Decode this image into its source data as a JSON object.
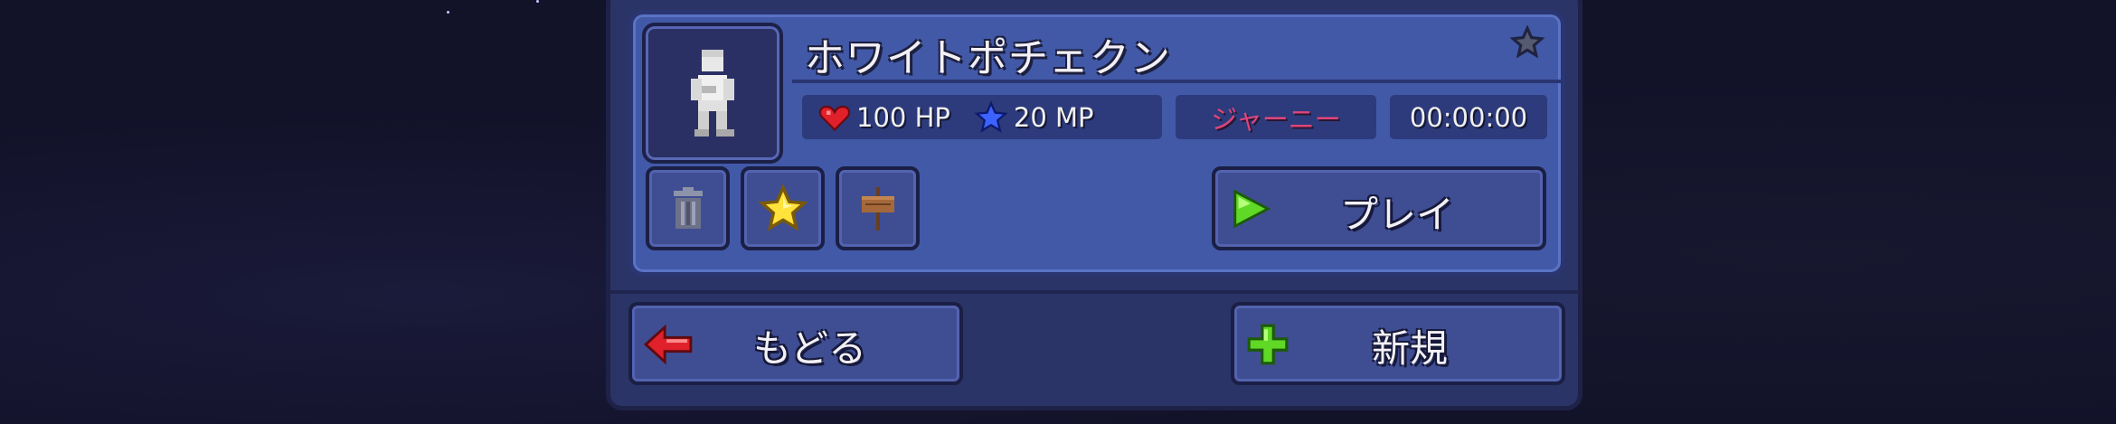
{
  "character": {
    "name": "ホワイトポチェクン",
    "hp": "100 HP",
    "mp": "20 MP",
    "mode": "ジャーニー",
    "playtime": "00:00:00"
  },
  "actions": {
    "play_label": "プレイ",
    "back_label": "もどる",
    "new_label": "新規"
  },
  "icons": {
    "delete": "trash-icon",
    "favorite": "star-icon",
    "rename": "sign-icon",
    "play": "play-triangle-icon",
    "back": "red-left-arrow-icon",
    "new": "green-plus-icon"
  },
  "colors": {
    "card": "#4259a8",
    "panel": "#2b3467",
    "mode_text": "#e0457a",
    "accent_green": "#6bdd2b"
  }
}
